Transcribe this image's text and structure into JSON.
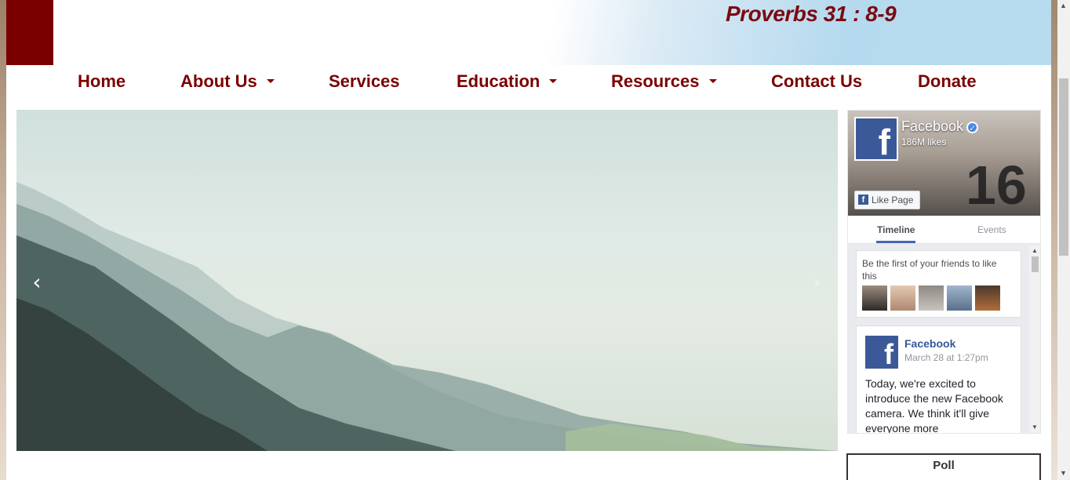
{
  "header": {
    "verse": "Proverbs 31 : 8-9",
    "brand_color": "#7a0000"
  },
  "nav": {
    "items": [
      {
        "label": "Home",
        "dropdown": false
      },
      {
        "label": "About Us",
        "dropdown": true
      },
      {
        "label": "Services",
        "dropdown": false
      },
      {
        "label": "Education",
        "dropdown": true
      },
      {
        "label": "Resources",
        "dropdown": true
      },
      {
        "label": "Contact Us",
        "dropdown": false
      },
      {
        "label": "Donate",
        "dropdown": false
      }
    ]
  },
  "carousel": {
    "prev_icon": "chevron-left-icon",
    "next_icon": "chevron-right-icon",
    "prev_glyph": "‹",
    "next_glyph": "›"
  },
  "facebook": {
    "page_name": "Facebook",
    "likes": "186M likes",
    "like_button": "Like Page",
    "tabs": [
      "Timeline",
      "Events"
    ],
    "friends_prompt": "Be the first of your friends to like this",
    "post": {
      "author": "Facebook",
      "date": "March 28 at 1:27pm",
      "text": "Today, we're excited to introduce the new Facebook camera. We think it'll give everyone more"
    }
  },
  "poll": {
    "title": "Poll"
  }
}
